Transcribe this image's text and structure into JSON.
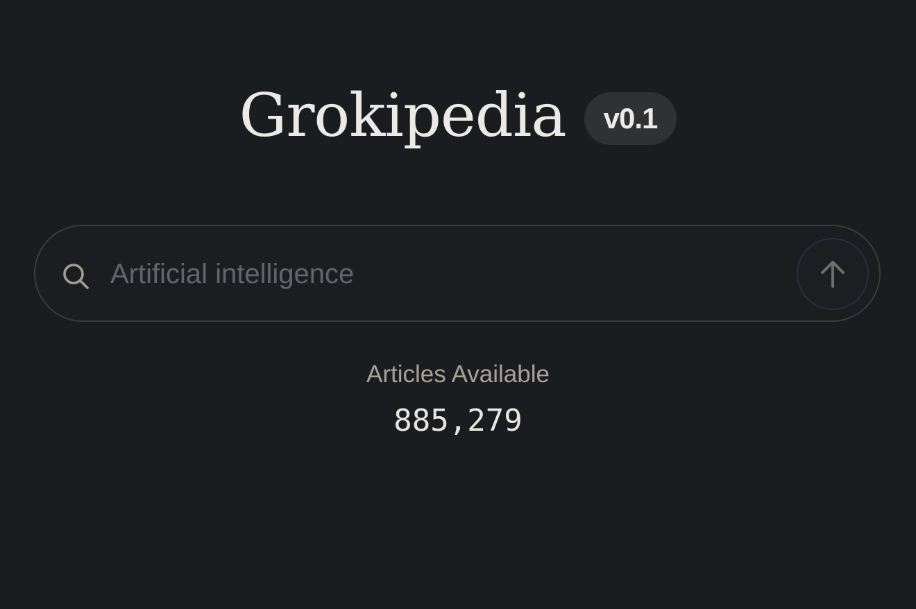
{
  "header": {
    "logo_text": "Grokipedia",
    "version_badge": "v0.1"
  },
  "search": {
    "placeholder": "Artificial intelligence",
    "value": "",
    "icon": "search-icon",
    "submit_icon": "arrow-up-icon"
  },
  "stats": {
    "label": "Articles Available",
    "count": "885,279"
  },
  "colors": {
    "background": "#1b1c1f",
    "logo_text": "#eceae5",
    "badge_bg": "#303133",
    "search_border": "#3a3b3e",
    "placeholder": "#64646a",
    "label_muted": "#a7a296"
  }
}
